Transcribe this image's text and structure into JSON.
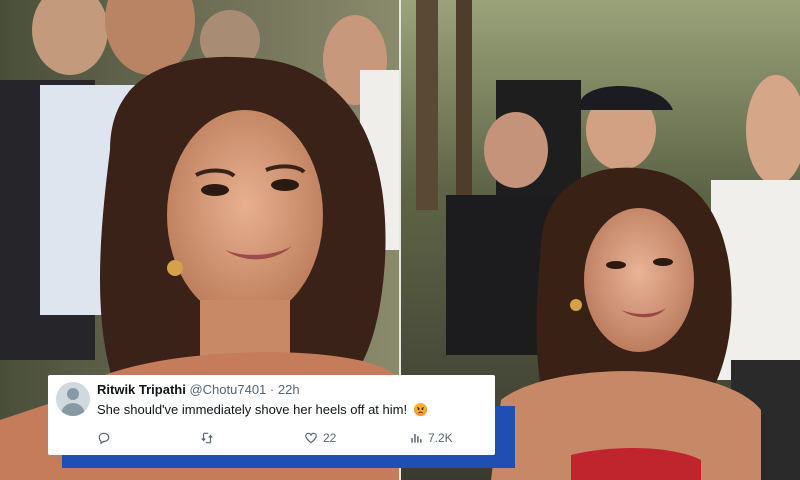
{
  "tweet": {
    "author_name": "Ritwik Tripathi",
    "handle": "@Chotu7401",
    "separator": "·",
    "time": "22h",
    "text": "She should've immediately shove her heels off at him!",
    "emoji": "angry-face-emoji",
    "actions": {
      "reply_icon": "reply-icon",
      "retweet_icon": "retweet-icon",
      "like_icon": "heart-icon",
      "like_count": "22",
      "views_icon": "views-bar-chart-icon",
      "view_count": "7.2K"
    }
  },
  "colors": {
    "accent_blue": "#1f4fb3",
    "card_bg": "#ffffff",
    "muted_text": "#536471",
    "primary_text": "#0f1419"
  }
}
